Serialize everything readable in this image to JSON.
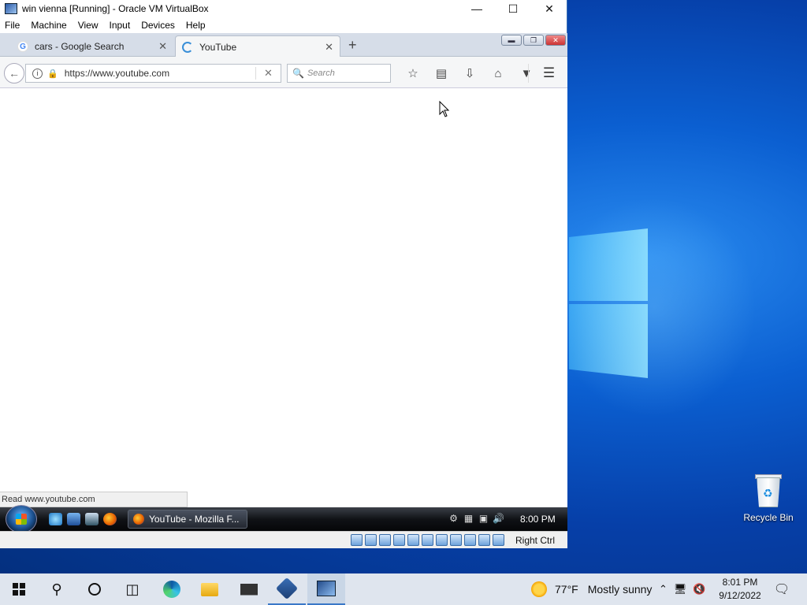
{
  "vbox": {
    "title": "win vienna [Running] - Oracle VM VirtualBox",
    "menu": [
      "File",
      "Machine",
      "View",
      "Input",
      "Devices",
      "Help"
    ],
    "status_host_key": "Right Ctrl"
  },
  "browser": {
    "tabs": [
      {
        "label": "cars - Google Search",
        "favicon": "google-icon",
        "active": false
      },
      {
        "label": "YouTube",
        "favicon": "loading-icon",
        "active": true
      }
    ],
    "url": "https://www.youtube.com",
    "search_placeholder": "Search",
    "status_text": "Read www.youtube.com"
  },
  "guest_taskbar": {
    "task_label": "YouTube - Mozilla F...",
    "clock": "8:00 PM"
  },
  "desktop": {
    "recycle_bin_label": "Recycle Bin"
  },
  "host_taskbar": {
    "weather_temp": "77°F",
    "weather_text": "Mostly sunny",
    "time": "8:01 PM",
    "date": "9/12/2022"
  },
  "colors": {
    "desktop_blue": "#0b5fd1",
    "vista_taskbar": "#101216",
    "host_taskbar": "#dfe5ee",
    "accent": "#3a78c8"
  }
}
